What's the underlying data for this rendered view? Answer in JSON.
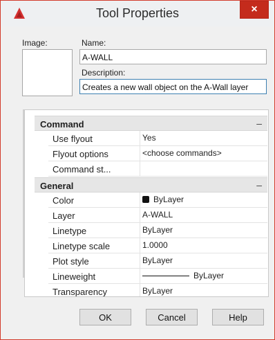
{
  "dialog": {
    "title": "Tool Properties",
    "close_glyph": "×"
  },
  "fields": {
    "image_label": "Image:",
    "name_label": "Name:",
    "name_value": "A-WALL",
    "description_label": "Description:",
    "description_value": "Creates a new wall object on the A-Wall layer"
  },
  "sections": [
    {
      "title": "Command",
      "toggle": "–",
      "rows": [
        {
          "name": "Use flyout",
          "value": "Yes"
        },
        {
          "name": "Flyout options",
          "value": "<choose commands>"
        },
        {
          "name": "Command  st...",
          "value": ""
        }
      ]
    },
    {
      "title": "General",
      "toggle": "–",
      "rows": [
        {
          "name": "Color",
          "value": "ByLayer",
          "swatch_color": "#111111"
        },
        {
          "name": "Layer",
          "value": "A-WALL"
        },
        {
          "name": "Linetype",
          "value": "ByLayer"
        },
        {
          "name": "Linetype scale",
          "value": "1.0000"
        },
        {
          "name": "Plot style",
          "value": "ByLayer"
        },
        {
          "name": "Lineweight",
          "value": "ByLayer"
        },
        {
          "name": "Transparency",
          "value": "ByLayer"
        }
      ]
    }
  ],
  "buttons": {
    "ok": "OK",
    "cancel": "Cancel",
    "help": "Help"
  },
  "colors": {
    "titlebar": "#eef0f2",
    "close_button": "#c42b1c",
    "accent_border": "#3c7fb1"
  }
}
